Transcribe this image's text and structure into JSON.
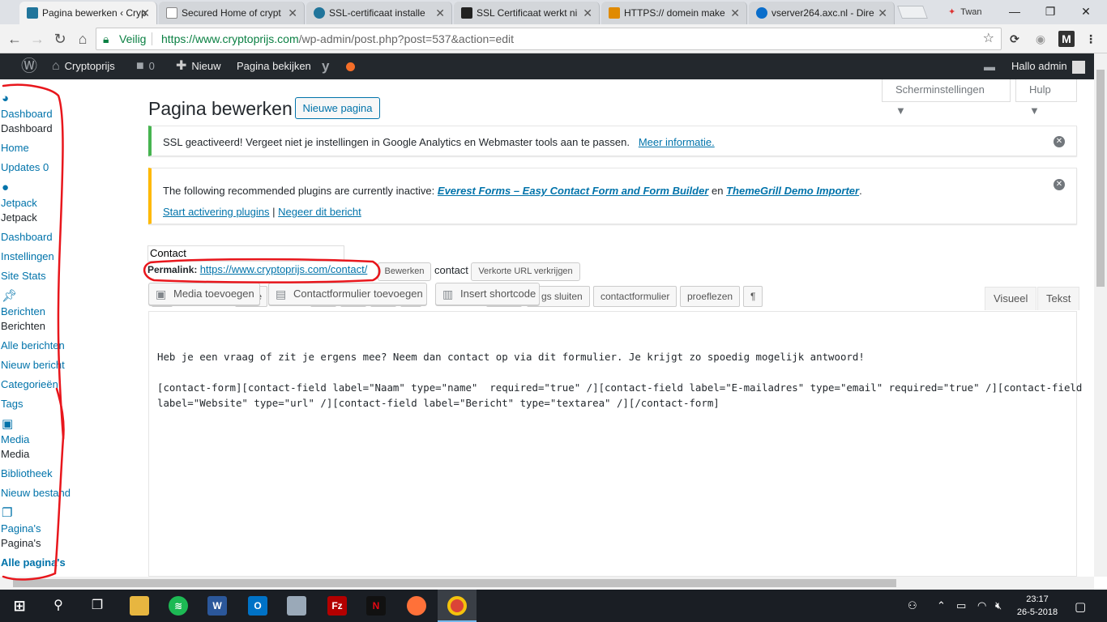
{
  "browser": {
    "tabs": [
      {
        "title": "Pagina bewerken ‹ Cryp",
        "favicon_color": "#21759b",
        "active": true
      },
      {
        "title": "Secured Home of crypt",
        "favicon_color": "#888888",
        "active": false
      },
      {
        "title": "SSL-certificaat installe",
        "favicon_color": "#21759b",
        "active": false
      },
      {
        "title": "SSL Certificaat werkt ni",
        "favicon_color": "#222222",
        "active": false
      },
      {
        "title": "HTTPS:// domein make",
        "favicon_color": "#e08a00",
        "active": false
      },
      {
        "title": "vserver264.axc.nl - Dire",
        "favicon_color": "#0a6ecb",
        "active": false
      }
    ],
    "profile_name": "Twan",
    "secure_label": "Veilig",
    "url_host": "https://www.cryptoprijs.com",
    "url_path": "/wp-admin/post.php?post=537&action=edit"
  },
  "adminbar": {
    "site_name": "Cryptoprijs",
    "comments_count": "0",
    "new_label": "Nieuw",
    "view_page": "Pagina bekijken",
    "greeting": "Hallo admin"
  },
  "sidebar": {
    "items": [
      {
        "label": "Dashboard",
        "style": "link"
      },
      {
        "label": "Dashboard",
        "style": "plain"
      },
      {
        "label": "Home",
        "style": "link"
      },
      {
        "label": "Updates 0",
        "style": "link"
      },
      {
        "label": "Jetpack",
        "style": "link"
      },
      {
        "label": "Jetpack",
        "style": "plain"
      },
      {
        "label": "Dashboard",
        "style": "link"
      },
      {
        "label": "Instellingen",
        "style": "link"
      },
      {
        "label": "Site Stats",
        "style": "link"
      },
      {
        "label": "Berichten",
        "style": "link"
      },
      {
        "label": "Berichten",
        "style": "plain"
      },
      {
        "label": "Alle berichten",
        "style": "link"
      },
      {
        "label": "Nieuw bericht",
        "style": "link"
      },
      {
        "label": "Categorieën",
        "style": "link"
      },
      {
        "label": "Tags",
        "style": "link"
      },
      {
        "label": "Media",
        "style": "link"
      },
      {
        "label": "Media",
        "style": "plain"
      },
      {
        "label": "Bibliotheek",
        "style": "link"
      },
      {
        "label": "Nieuw bestand",
        "style": "link"
      },
      {
        "label": "Pagina's",
        "style": "link"
      },
      {
        "label": "Pagina's",
        "style": "plain"
      },
      {
        "label": "Alle pagina's",
        "style": "bold"
      }
    ]
  },
  "header": {
    "title": "Pagina bewerken",
    "new_page": "Nieuwe pagina",
    "screen_options": "Scherminstellingen ▼",
    "help": "Hulp ▼"
  },
  "notices": {
    "ssl": {
      "text": "SSL geactiveerd!  Vergeet niet je instellingen in Google Analytics en Webmaster tools aan te passen.",
      "link": "Meer informatie."
    },
    "plugins": {
      "text": "The following recommended plugins are currently inactive:",
      "plugin1": "Everest Forms – Easy Contact Form and Form Builder",
      "joiner": "en",
      "plugin2": "ThemeGrill Demo Importer",
      "end": ".",
      "start_link": "Start activering plugins",
      "divider": "|",
      "dismiss_link": "Negeer dit bericht"
    }
  },
  "editor": {
    "title_value": "Contact",
    "permalink_label": "Permalink:",
    "permalink_url": "https://www.cryptoprijs.com/contact/",
    "edit_button": "Bewerken",
    "slug": "contact",
    "shortlink_button": "Verkorte URL verkrijgen",
    "media_button": "Media toevoegen",
    "contact_form_button": "Contactformulier toevoegen",
    "shortcode_button": "Insert shortcode",
    "qt_buttons": [
      "te",
      "gs sluiten",
      "contactformulier",
      "proeflezen",
      "¶"
    ],
    "tab_visual": "Visueel",
    "tab_text": "Tekst",
    "content_lines": [
      "Heb je een vraag of zit je ergens mee? Neem dan contact op via dit formulier. Je krijgt zo spoedig mogelijk antwoord!",
      "[contact-form][contact-field label=\"Naam\" type=\"name\"  required=\"true\" /][contact-field label=\"E-mailadres\" type=\"email\" required=\"true\" /][contact-field",
      "label=\"Website\" type=\"url\" /][contact-field label=\"Bericht\" type=\"textarea\" /][/contact-form]"
    ]
  },
  "taskbar": {
    "time": "23:17",
    "date": "26-5-2018"
  },
  "colors": {
    "wp_link": "#0073aa",
    "adminbar_bg": "#23282d",
    "notice_success": "#46b450",
    "notice_warning": "#ffb900",
    "annotation_red": "#e8161c"
  }
}
